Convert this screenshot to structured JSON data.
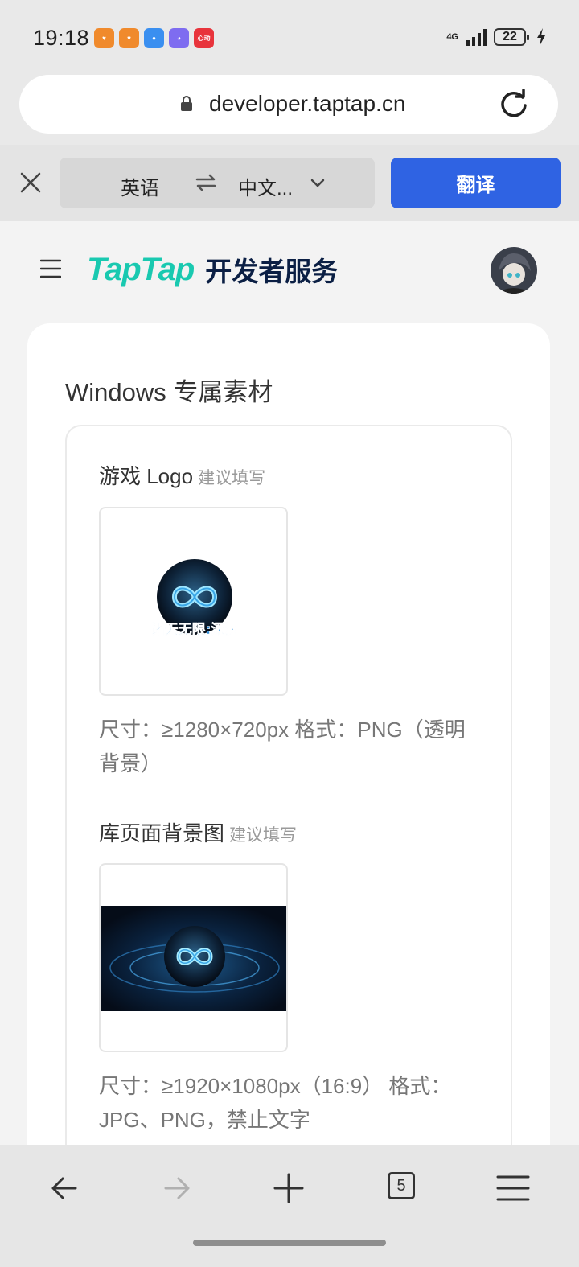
{
  "status_bar": {
    "time": "19:18",
    "network": "4G",
    "battery": "22",
    "notification_icons": [
      "heart-app-icon",
      "heart-app-icon",
      "weather-icon",
      "ai-assistant-icon",
      "news-app-icon"
    ],
    "news_app_label": "心动"
  },
  "browser": {
    "url": "developer.taptap.cn"
  },
  "translate_bar": {
    "source_language": "英语",
    "target_language": "中文...",
    "translate_button": "翻译"
  },
  "site": {
    "logo_tap": "TapTap",
    "logo_subtitle": "开发者服务"
  },
  "section": {
    "title": "Windows 专属素材",
    "fields": [
      {
        "label": "游戏 Logo",
        "hint": "建议填写",
        "image_text": "诸天无限:深渊",
        "description": "尺寸：≥1280×720px 格式：PNG（透明背景）"
      },
      {
        "label": "库页面背景图",
        "hint": "建议填写",
        "description": "尺寸：≥1920×1080px（16:9） 格式：JPG、PNG，禁止文字"
      }
    ]
  },
  "bottom_nav": {
    "tab_count": "5"
  },
  "colors": {
    "brand_teal": "#19c9b0",
    "brand_navy": "#0b1f44",
    "translate_blue": "#2f63e3"
  }
}
